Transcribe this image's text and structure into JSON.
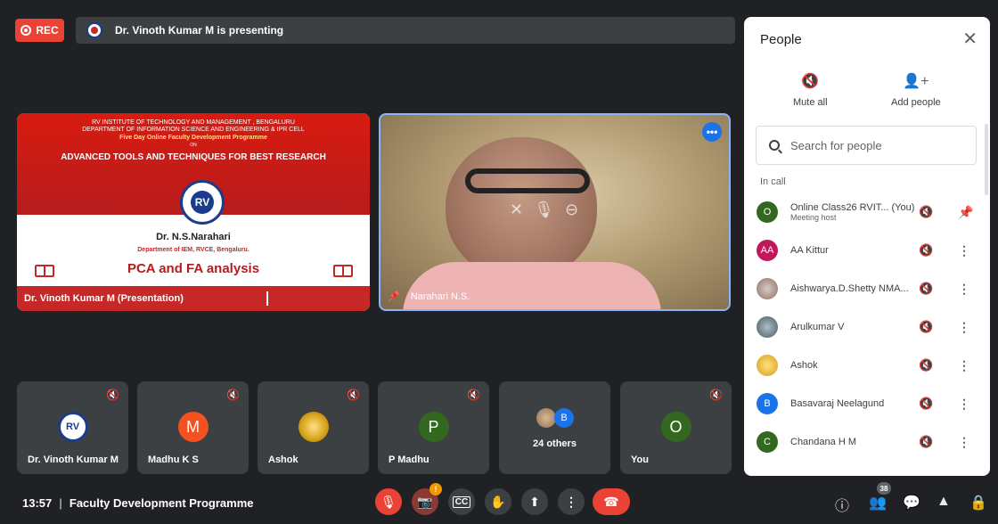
{
  "top": {
    "rec_label": "REC",
    "presenting_text": "Dr. Vinoth Kumar M is presenting"
  },
  "slide": {
    "line1": "RV INSTITUTE OF TECHNOLOGY AND MANAGEMENT , BENGALURU",
    "line2": "DEPARTMENT OF INFORMATION SCIENCE AND ENGINEERING & IPR CELL",
    "line3": "Five Day Online Faculty Development Programme",
    "line4": "ON",
    "line5": "ADVANCED TOOLS AND TECHNIQUES FOR BEST RESEARCH",
    "logo_text": "RV",
    "speaker": "Dr. N.S.Narahari",
    "dept": "Department of IEM, RVCE, Bengaluru.",
    "topic": "PCA and FA analysis",
    "bar_label": "Dr. Vinoth Kumar M (Presentation)"
  },
  "video": {
    "name": "Narahari N.S.",
    "more": "•••"
  },
  "tiles": [
    {
      "name": "Dr. Vinoth Kumar M",
      "initial": "RV",
      "color": "#ffffff"
    },
    {
      "name": "Madhu K S",
      "initial": "M",
      "color": "#f4511e"
    },
    {
      "name": "Ashok",
      "initial": "",
      "color": "#d4a017"
    },
    {
      "name": "P Madhu",
      "initial": "P",
      "color": "#33691e"
    },
    {
      "name": "24 others",
      "initial": "B",
      "color": "#1a73e8"
    },
    {
      "name": "You",
      "initial": "O",
      "color": "#33691e"
    }
  ],
  "controls": {
    "time": "13:57",
    "meeting_title": "Faculty Development Programme",
    "participant_count": "38",
    "cam_badge": "!"
  },
  "panel": {
    "title": "People",
    "mute_all": "Mute all",
    "add_people": "Add people",
    "search_placeholder": "Search for people",
    "in_call": "In call",
    "people": [
      {
        "name": "Online Class26 RVIT... (You)",
        "sub": "Meeting host",
        "initial": "O",
        "color": "#33691e"
      },
      {
        "name": "AA Kittur",
        "sub": "",
        "initial": "AA",
        "color": "#c2185b"
      },
      {
        "name": "Aishwarya.D.Shetty NMA...",
        "sub": "",
        "initial": "",
        "color": "#8d6e63"
      },
      {
        "name": "Arulkumar V",
        "sub": "",
        "initial": "",
        "color": "#5d7a8c"
      },
      {
        "name": "Ashok",
        "sub": "",
        "initial": "",
        "color": "#d4a017"
      },
      {
        "name": "Basavaraj Neelagund",
        "sub": "",
        "initial": "B",
        "color": "#1a73e8"
      },
      {
        "name": "Chandana H M",
        "sub": "",
        "initial": "C",
        "color": "#33691e"
      }
    ]
  }
}
